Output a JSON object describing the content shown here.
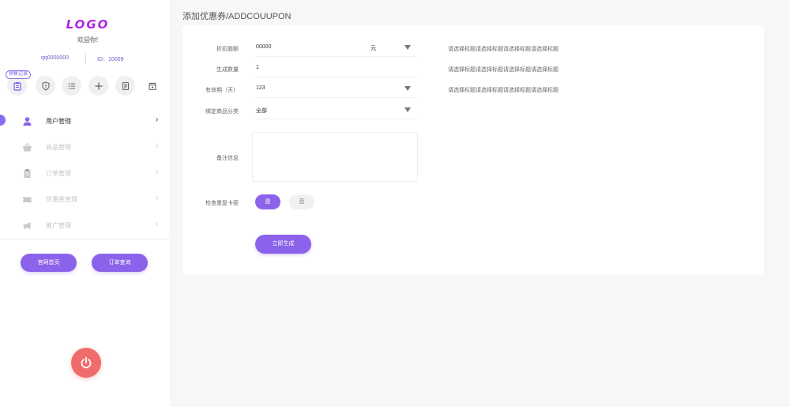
{
  "brand": {
    "logo": "LOGO",
    "welcome": "欢迎你!"
  },
  "account": {
    "qq": "qq0000000",
    "id": "ID：10009"
  },
  "quick_actions": {
    "badge": "销售记录",
    "icons": [
      "clipboard-icon",
      "shield-alert-icon",
      "list-icon",
      "plus-icon",
      "document-icon",
      "calendar-icon"
    ]
  },
  "sidebar": {
    "items": [
      {
        "label": "用户管理",
        "icon": "user-icon",
        "active": true
      },
      {
        "label": "商品管理",
        "icon": "basket-icon",
        "active": false
      },
      {
        "label": "订单管理",
        "icon": "clipboard-icon",
        "active": false
      },
      {
        "label": "优惠券管理",
        "icon": "ticket-icon",
        "active": false
      },
      {
        "label": "推广管理",
        "icon": "megaphone-icon",
        "active": false
      }
    ],
    "arrow": "›",
    "buttons": {
      "home": "官网首页",
      "orders": "订单查询"
    }
  },
  "page": {
    "title": "添加优惠券/ADDCOUUPON"
  },
  "form": {
    "discount": {
      "label": "折扣面额",
      "value": "00000",
      "unit": "元",
      "hint": "请选择标题请选择标题请选择标题请选择标题"
    },
    "quantity": {
      "label": "生成数量",
      "value": "1",
      "hint": "请选择标题请选择标题请选择标题请选择标题"
    },
    "validity": {
      "label": "有效期（天）",
      "value": "123",
      "hint": "请选择标题请选择标题请选择标题请选择标题"
    },
    "category": {
      "label": "绑定商品分类",
      "value": "全部"
    },
    "remark": {
      "label": "备注信息",
      "value": ""
    },
    "check_duplicate": {
      "label": "检查重复卡密",
      "yes": "是",
      "no": "否",
      "selected": "yes"
    },
    "submit": "立即生成"
  },
  "colors": {
    "accent": "#8b63ea",
    "logo": "#b026e0",
    "power": "#f06b6b"
  }
}
